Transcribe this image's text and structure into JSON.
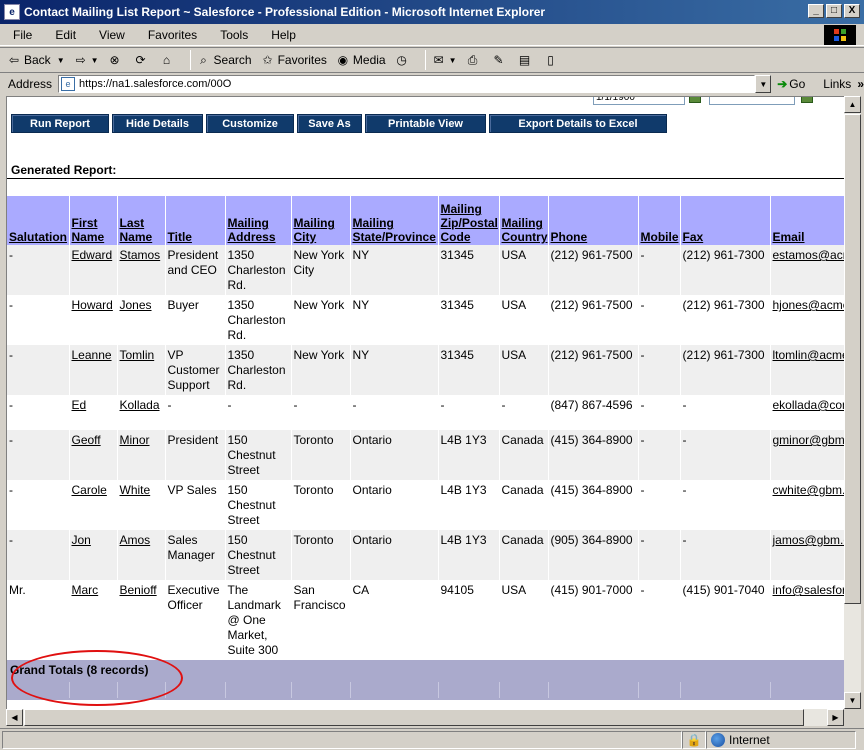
{
  "window": {
    "title": "Contact Mailing List Report ~ Salesforce - Professional Edition - Microsoft Internet Explorer",
    "min": "_",
    "max": "□",
    "close": "X"
  },
  "menu": [
    "File",
    "Edit",
    "View",
    "Favorites",
    "Tools",
    "Help"
  ],
  "toolbar": {
    "back": "Back",
    "search": "Search",
    "favorites": "Favorites",
    "media": "Media"
  },
  "address": {
    "label": "Address",
    "url": "https://na1.salesforce.com/00O",
    "go": "Go",
    "links": "Links"
  },
  "page_top": {
    "cut_date_value": "1/1/1900"
  },
  "buttons": [
    "Run Report",
    "Hide Details",
    "Customize",
    "Save As",
    "Printable View",
    "Export Details to Excel"
  ],
  "report": {
    "generated_label": "Generated Report:",
    "columns": [
      "Salutation",
      "First Name",
      "Last Name",
      "Title",
      "Mailing Address",
      "Mailing City",
      "Mailing State/Province",
      "Mailing Zip/Postal Code",
      "Mailing Country",
      "Phone",
      "Mobile",
      "Fax",
      "Email"
    ],
    "rows": [
      [
        "-",
        "Edward",
        "Stamos",
        "President and CEO",
        "1350 Charleston Rd.",
        "New York City",
        "NY",
        "31345",
        "USA",
        "(212) 961-7500",
        "-",
        "(212) 961-7300",
        "estamos@acme.com"
      ],
      [
        "-",
        "Howard",
        "Jones",
        "Buyer",
        "1350 Charleston Rd.",
        "New York",
        "NY",
        "31345",
        "USA",
        "(212) 961-7500",
        "-",
        "(212) 961-7300",
        "hjones@acme.com"
      ],
      [
        "-",
        "Leanne",
        "Tomlin",
        "VP Customer Support",
        "1350 Charleston Rd.",
        "New York",
        "NY",
        "31345",
        "USA",
        "(212) 961-7500",
        "-",
        "(212) 961-7300",
        "ltomlin@acme.com"
      ],
      [
        "-",
        "Ed",
        "Kollada",
        "-",
        "-",
        "-",
        "-",
        "-",
        "-",
        "(847) 867-4596",
        "-",
        "-",
        "ekollada@company.com"
      ],
      [
        "-",
        "Geoff",
        "Minor",
        "President",
        "150 Chestnut Street",
        "Toronto",
        "Ontario",
        "L4B 1Y3",
        "Canada",
        "(415) 364-8900",
        "-",
        "-",
        "gminor@gbm.com"
      ],
      [
        "-",
        "Carole",
        "White",
        "VP Sales",
        "150 Chestnut Street",
        "Toronto",
        "Ontario",
        "L4B 1Y3",
        "Canada",
        "(415) 364-8900",
        "-",
        "-",
        "cwhite@gbm.com"
      ],
      [
        "-",
        "Jon",
        "Amos",
        "Sales Manager",
        "150 Chestnut Street",
        "Toronto",
        "Ontario",
        "L4B 1Y3",
        "Canada",
        "(905) 364-8900",
        "-",
        "-",
        "jamos@gbm.com"
      ],
      [
        "Mr.",
        "Marc",
        "Benioff",
        "Executive Officer",
        "The Landmark @ One Market, Suite 300",
        "San Francisco",
        "CA",
        "94105",
        "USA",
        "(415) 901-7000",
        "-",
        "(415) 901-7040",
        "info@salesforce.com"
      ]
    ],
    "grand_totals": "Grand Totals (8 records)"
  },
  "status": {
    "zone": "Internet"
  },
  "colors": {
    "header_bg": "#aaaaff",
    "button_bg": "#103a6b",
    "totals_bg": "#aaaacc",
    "annotation": "#e01010"
  }
}
